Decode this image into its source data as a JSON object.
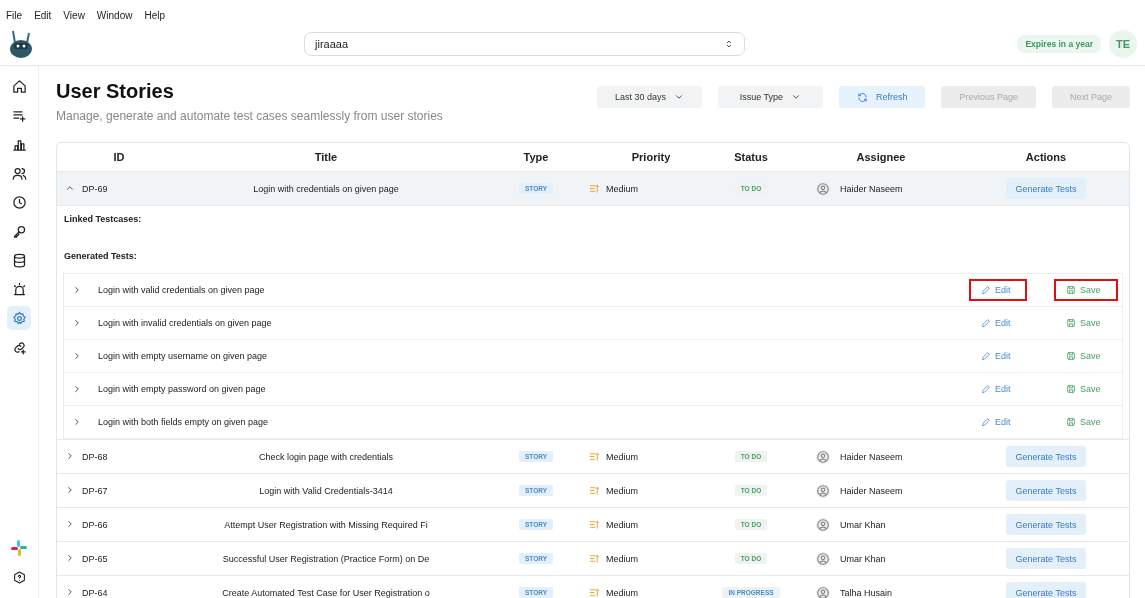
{
  "menu": [
    "File",
    "Edit",
    "View",
    "Window",
    "Help"
  ],
  "project_select": {
    "value": "jiraaaa"
  },
  "license_badge": "Expires in a year",
  "avatar": "TE",
  "sidebar": {
    "items": [
      {
        "selected": false
      },
      {
        "selected": false
      },
      {
        "selected": false
      },
      {
        "selected": false
      },
      {
        "selected": false
      },
      {
        "selected": false
      },
      {
        "selected": false
      },
      {
        "selected": false
      },
      {
        "selected": true
      },
      {
        "selected": false
      }
    ]
  },
  "page": {
    "title": "User Stories",
    "subtitle": "Manage, generate and automate test cases seamlessly from user stories"
  },
  "toolbar": {
    "date_filter": "Last 30 days",
    "type_filter": "Issue Type",
    "refresh": "Refresh",
    "previous": {
      "label": "Previous Page",
      "disabled": true
    },
    "next": {
      "label": "Next Page",
      "disabled": true
    }
  },
  "table": {
    "columns": [
      "ID",
      "Title",
      "Type",
      "Priority",
      "Status",
      "Assignee",
      "Actions"
    ],
    "rows": [
      {
        "id": "DP-69",
        "title": "Login with credentials on given page",
        "type": "STORY",
        "priority": "Medium",
        "status": "TO DO",
        "color": "#4aa05e",
        "assignee": "Haider Naseem",
        "action": "Generate Tests",
        "expanded": true,
        "details": {
          "linked_label": "Linked Testcases:",
          "generated_label": "Generated Tests:",
          "tests": [
            {
              "title": "Login with valid credentials on given page",
              "edit": "Edit",
              "save": "Save",
              "highlighted": true
            },
            {
              "title": "Login with invalid credentials on given page",
              "edit": "Edit",
              "save": "Save",
              "highlighted": false
            },
            {
              "title": "Login with empty username on given page",
              "edit": "Edit",
              "save": "Save",
              "highlighted": false
            },
            {
              "title": "Login with empty password on given page",
              "edit": "Edit",
              "save": "Save",
              "highlighted": false
            },
            {
              "title": "Login with both fields empty on given page",
              "edit": "Edit",
              "save": "Save",
              "highlighted": false
            }
          ]
        }
      },
      {
        "id": "DP-68",
        "title": "Check login page with credentials",
        "type": "STORY",
        "priority": "Medium",
        "status": "TO DO",
        "color": "#4aa05e",
        "assignee": "Haider Naseem",
        "action": "Generate Tests",
        "expanded": false
      },
      {
        "id": "DP-67",
        "title": "Login with Valid Credentials-3414",
        "type": "STORY",
        "priority": "Medium",
        "status": "TO DO",
        "color": "#4aa05e",
        "assignee": "Haider Naseem",
        "action": "Generate Tests",
        "expanded": false
      },
      {
        "id": "DP-66",
        "title": "Attempt User Registration with Missing Required Fi",
        "type": "STORY",
        "priority": "Medium",
        "status": "TO DO",
        "color": "#4aa05e",
        "assignee": "Umar Khan",
        "action": "Generate Tests",
        "expanded": false
      },
      {
        "id": "DP-65",
        "title": "Successful User Registration (Practice Form) on De",
        "type": "STORY",
        "priority": "Medium",
        "status": "TO DO",
        "color": "#4aa05e",
        "assignee": "Umar Khan",
        "action": "Generate Tests",
        "expanded": false
      },
      {
        "id": "DP-64",
        "title": "Create Automated Test Case for User Registration o",
        "type": "STORY",
        "priority": "Medium",
        "status": "IN PROGRESS",
        "color": "#4a8ccc",
        "assignee": "Talha Husain",
        "action": "Generate Tests",
        "expanded": false
      }
    ]
  }
}
